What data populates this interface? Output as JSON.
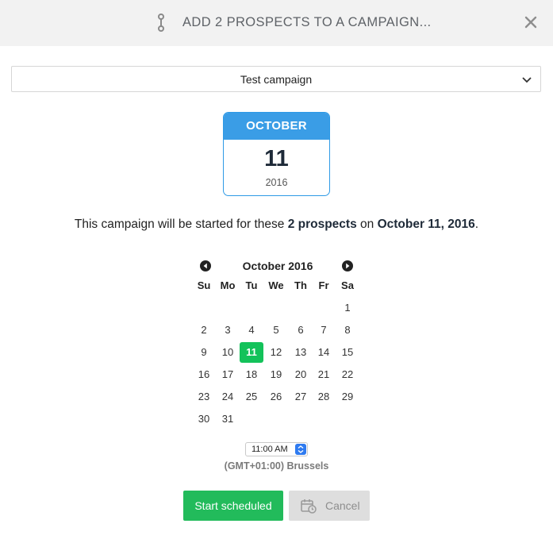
{
  "header": {
    "title": "ADD 2 PROSPECTS TO A CAMPAIGN..."
  },
  "campaign_select": {
    "value": "Test campaign"
  },
  "date_card": {
    "month": "OCTOBER",
    "day": "11",
    "year": "2016"
  },
  "summary": {
    "prefix": "This campaign will be started for these ",
    "count": "2 prospects",
    "middle": " on ",
    "date": "October 11, 2016",
    "suffix": "."
  },
  "calendar": {
    "title": "October 2016",
    "weekdays": [
      "Su",
      "Mo",
      "Tu",
      "We",
      "Th",
      "Fr",
      "Sa"
    ],
    "first_weekday_index": 6,
    "days_in_month": 31,
    "selected_day": 11
  },
  "time": {
    "value": "11:00 AM",
    "timezone": "(GMT+01:00) Brussels"
  },
  "buttons": {
    "start": "Start scheduled",
    "cancel": "Cancel"
  },
  "colors": {
    "accent_blue": "#3a9de6",
    "selected_green": "#13c25a",
    "start_green": "#22bb5b"
  },
  "icons": {
    "header": "stepper-icon",
    "close": "close-icon",
    "select": "chevron-down-icon",
    "prev": "arrow-left-circle-icon",
    "next": "arrow-right-circle-icon",
    "cancel": "calendar-clock-icon"
  }
}
